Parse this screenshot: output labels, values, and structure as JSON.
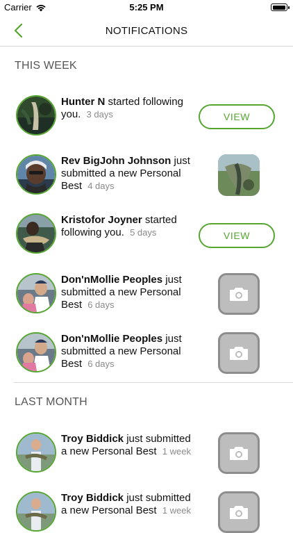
{
  "status_bar": {
    "carrier": "Carrier",
    "time": "5:25 PM"
  },
  "nav": {
    "title": "NOTIFICATIONS"
  },
  "sections": [
    {
      "header": "THIS WEEK",
      "items": [
        {
          "name": "Hunter N",
          "text": "started following you.",
          "time": "3 days",
          "action": "VIEW"
        },
        {
          "name": "Rev BigJohn Johnson",
          "text": "just submitted a new Personal Best",
          "time": "4 days",
          "action": "photo"
        },
        {
          "name": "Kristofor Joyner",
          "text": "started following you.",
          "time": "5 days",
          "action": "VIEW"
        },
        {
          "name": "Don'nMollie Peoples",
          "text": "just submitted a new Personal Best",
          "time": "6 days",
          "action": "camera-placeholder"
        },
        {
          "name": "Don'nMollie Peoples",
          "text": "just submitted a new Personal Best",
          "time": "6 days",
          "action": "camera-placeholder"
        }
      ]
    },
    {
      "header": "LAST MONTH",
      "items": [
        {
          "name": "Troy Biddick",
          "text": "just submitted a new Personal Best",
          "time": "1 week",
          "action": "camera-placeholder"
        },
        {
          "name": "Troy Biddick",
          "text": "just submitted a new Personal Best",
          "time": "1 week",
          "action": "camera-placeholder"
        }
      ]
    }
  ],
  "colors": {
    "accent": "#55a630",
    "placeholder_bg": "#bdbdbd",
    "placeholder_border": "#8d8d8d",
    "muted": "#8a8a8a"
  },
  "icons": {
    "back": "chevron-left-icon",
    "camera": "camera-icon",
    "wifi": "wifi-icon",
    "battery": "battery-icon"
  }
}
